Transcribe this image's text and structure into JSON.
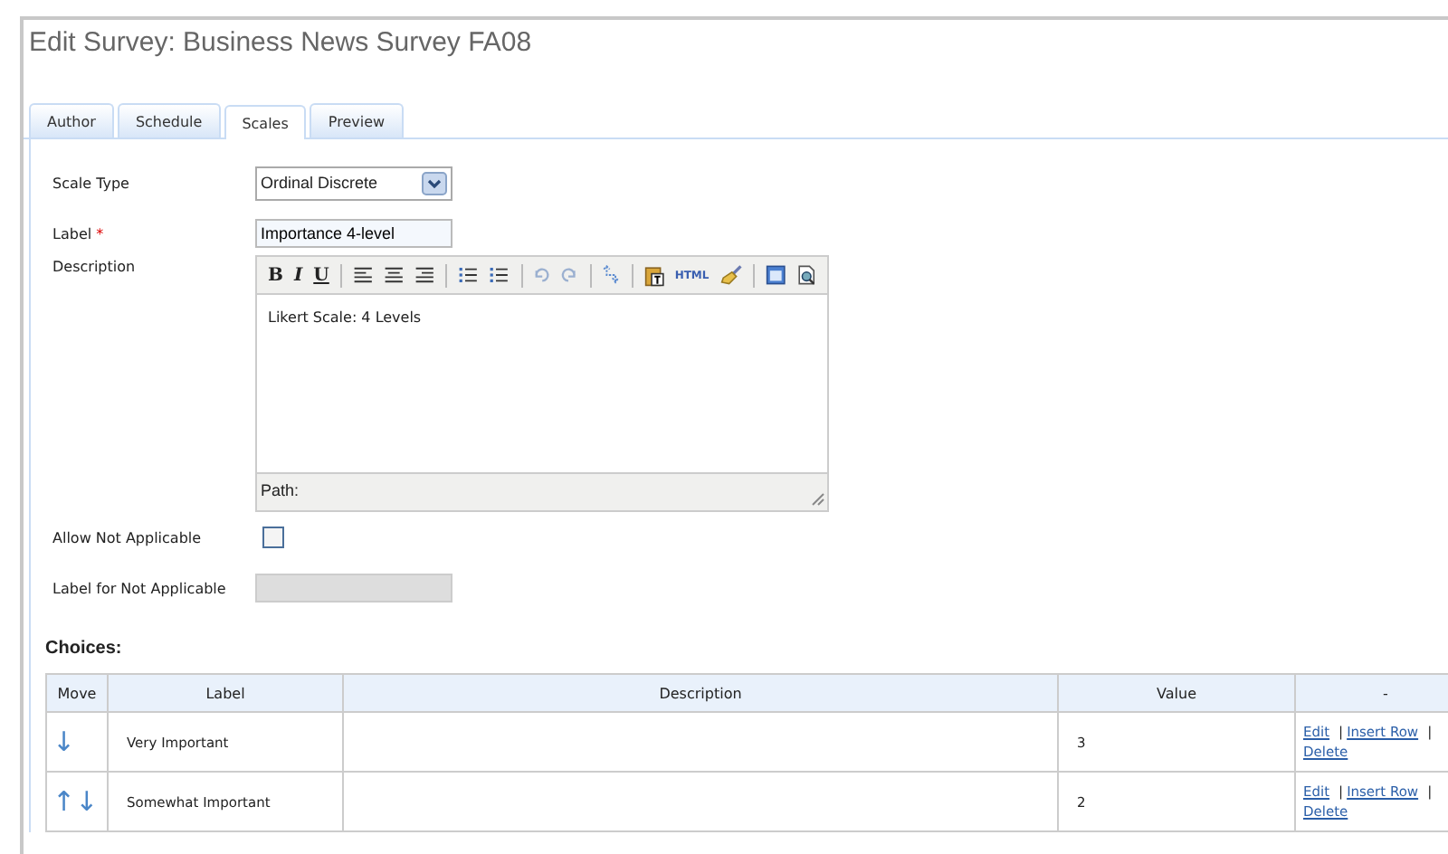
{
  "page": {
    "title": "Edit Survey: Business News Survey FA08"
  },
  "tabs": [
    {
      "label": "Author",
      "selected": false
    },
    {
      "label": "Schedule",
      "selected": false
    },
    {
      "label": "Scales",
      "selected": true
    },
    {
      "label": "Preview",
      "selected": false
    }
  ],
  "form": {
    "scale_type": {
      "label": "Scale Type",
      "value": "Ordinal Discrete"
    },
    "label": {
      "label": "Label",
      "required_mark": "*",
      "value": "Importance 4-level"
    },
    "description": {
      "label": "Description",
      "text": "Likert Scale: 4 Levels",
      "path_label": "Path:",
      "toolbar": [
        {
          "kind": "bold",
          "label": "B"
        },
        {
          "kind": "italic",
          "label": "I"
        },
        {
          "kind": "underline",
          "label": "U"
        },
        {
          "kind": "sep"
        },
        {
          "kind": "align-left"
        },
        {
          "kind": "align-center"
        },
        {
          "kind": "align-right"
        },
        {
          "kind": "sep"
        },
        {
          "kind": "bullets"
        },
        {
          "kind": "numbers"
        },
        {
          "kind": "sep"
        },
        {
          "kind": "undo"
        },
        {
          "kind": "redo"
        },
        {
          "kind": "sep"
        },
        {
          "kind": "replace"
        },
        {
          "kind": "sep"
        },
        {
          "kind": "paste"
        },
        {
          "kind": "html",
          "label": "HTML"
        },
        {
          "kind": "clean"
        },
        {
          "kind": "sep"
        },
        {
          "kind": "window"
        },
        {
          "kind": "preview"
        }
      ]
    },
    "allow_na": {
      "label": "Allow Not Applicable",
      "checked": false
    },
    "na_label": {
      "label": "Label for Not Applicable",
      "disabled": true
    }
  },
  "choices": {
    "heading": "Choices:",
    "columns": [
      "Move",
      "Label",
      "Description",
      "Value",
      "-"
    ],
    "rows": [
      {
        "move": "↓",
        "label": "Very Important",
        "value": "3",
        "actions": [
          {
            "label": "Edit"
          },
          {
            "sep": "|",
            "label": "Insert Row"
          },
          {
            "sep": "|",
            "label": "Delete"
          }
        ]
      },
      {
        "move": "↑↓",
        "label": "Somewhat Important",
        "value": "2",
        "actions": [
          {
            "label": "Edit"
          },
          {
            "sep": "|",
            "label": "Insert Row"
          },
          {
            "sep": "|",
            "label": "Delete"
          }
        ]
      }
    ]
  }
}
